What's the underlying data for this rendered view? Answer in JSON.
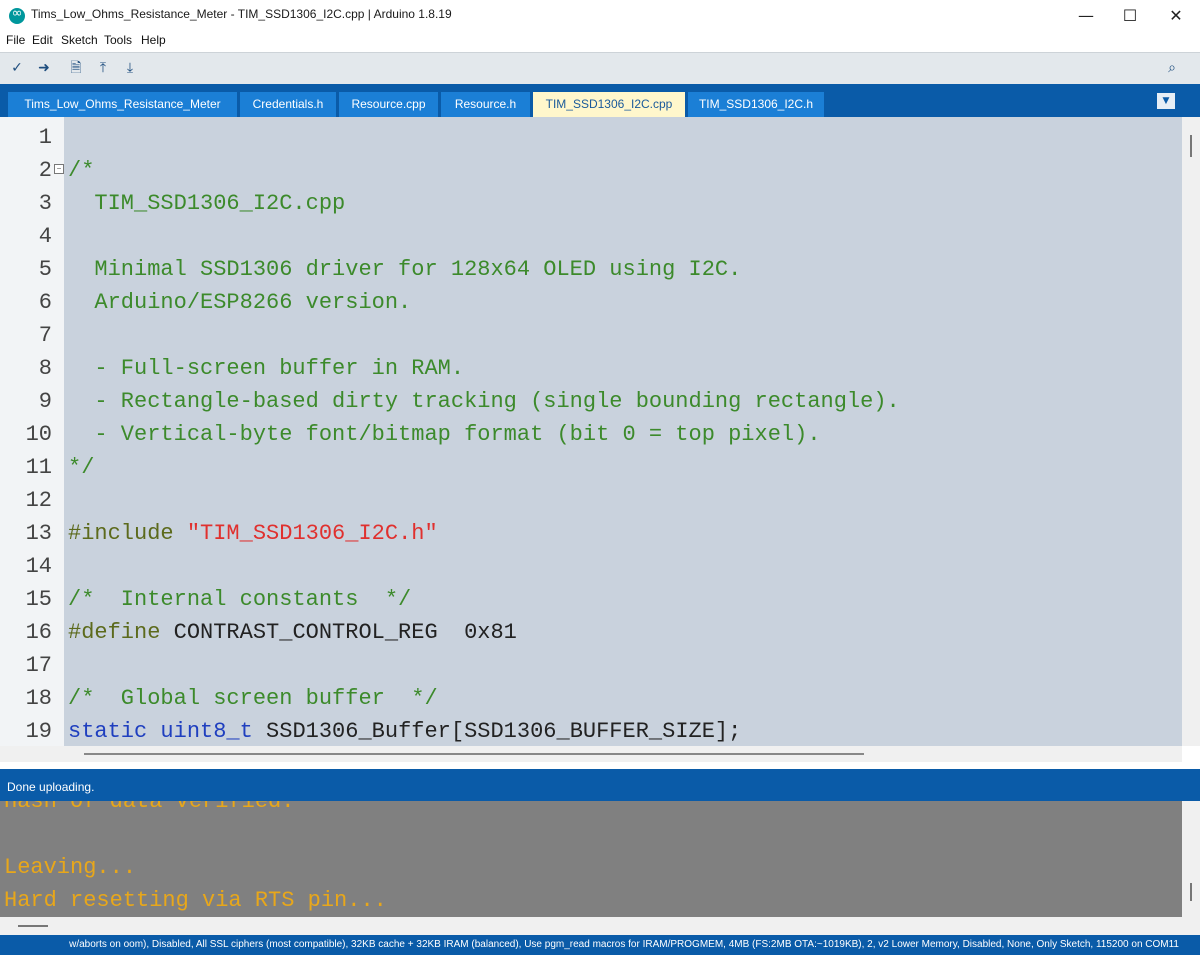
{
  "window": {
    "title": "Tims_Low_Ohms_Resistance_Meter - TIM_SSD1306_I2C.cpp | Arduino 1.8.19",
    "logo_icon": "arduino-logo-icon",
    "minimize_glyph": "—",
    "maximize_glyph": "☐",
    "close_glyph": "✕"
  },
  "menu": {
    "items": [
      "File",
      "Edit",
      "Sketch",
      "Tools",
      "Help"
    ]
  },
  "toolbar": {
    "verify_glyph": "✓",
    "upload_glyph": "➜",
    "new_glyph": "🗎",
    "open_glyph": "⤒",
    "save_glyph": "⤓",
    "serial_monitor_glyph": "⌕",
    "icons": [
      "verify-icon",
      "upload-icon",
      "new-icon",
      "open-icon",
      "save-icon",
      "serial-monitor-icon"
    ]
  },
  "tabs": {
    "items": [
      {
        "label": "Tims_Low_Ohms_Resistance_Meter",
        "active": false
      },
      {
        "label": "Credentials.h",
        "active": false
      },
      {
        "label": "Resource.cpp",
        "active": false
      },
      {
        "label": "Resource.h",
        "active": false
      },
      {
        "label": "TIM_SSD1306_I2C.cpp",
        "active": true
      },
      {
        "label": "TIM_SSD1306_I2C.h",
        "active": false
      }
    ],
    "menu_glyph": "▼"
  },
  "editor": {
    "line_numbers": [
      "1",
      "2",
      "3",
      "4",
      "5",
      "6",
      "7",
      "8",
      "9",
      "10",
      "11",
      "12",
      "13",
      "14",
      "15",
      "16",
      "17",
      "18",
      "19"
    ],
    "fold_glyph": "−",
    "lines": [
      "",
      "/*",
      "  TIM_SSD1306_I2C.cpp",
      "",
      "  Minimal SSD1306 driver for 128x64 OLED using I2C.",
      "  Arduino/ESP8266 version.",
      "",
      "  - Full-screen buffer in RAM.",
      "  - Rectangle-based dirty tracking (single bounding rectangle).",
      "  - Vertical-byte font/bitmap format (bit 0 = top pixel).",
      "*/",
      "",
      "#include \"TIM_SSD1306_I2C.h\"",
      "",
      "/*  Internal constants  */",
      "#define CONTRAST_CONTROL_REG  0x81",
      "",
      "/*  Global screen buffer  */",
      "static uint8_t SSD1306_Buffer[SSD1306_BUFFER_SIZE];"
    ],
    "tokens": {
      "include_kw": "#include",
      "include_file": "\"TIM_SSD1306_I2C.h\"",
      "define_kw": "#define",
      "define_rest": " CONTRAST_CONTROL_REG  0x81",
      "static_kw": "static",
      "type_kw": "uint8_t",
      "buffer_rest": " SSD1306_Buffer[SSD1306_BUFFER_SIZE];"
    }
  },
  "status": {
    "message": "Done uploading."
  },
  "console": {
    "lines": [
      "Hash of data verified.",
      "",
      "Leaving...",
      "Hard resetting via RTS pin..."
    ]
  },
  "board": {
    "summary": "w/aborts on oom), Disabled, All SSL ciphers (most compatible), 32KB cache + 32KB IRAM (balanced), Use pgm_read macros for IRAM/PROGMEM, 4MB (FS:2MB OTA:~1019KB), 2, v2 Lower Memory, Disabled, None, Only Sketch, 115200 on COM11"
  },
  "colors": {
    "tab_bar": "#0a5ba8",
    "tab": "#1b7fd6",
    "active_tab": "#fff7cc",
    "selection": "#c9d2dd",
    "comment": "#3c8a2b",
    "string": "#e0302e",
    "keyword": "#1f3fbf",
    "console_bg": "#808080",
    "console_text": "#e8a71a"
  }
}
